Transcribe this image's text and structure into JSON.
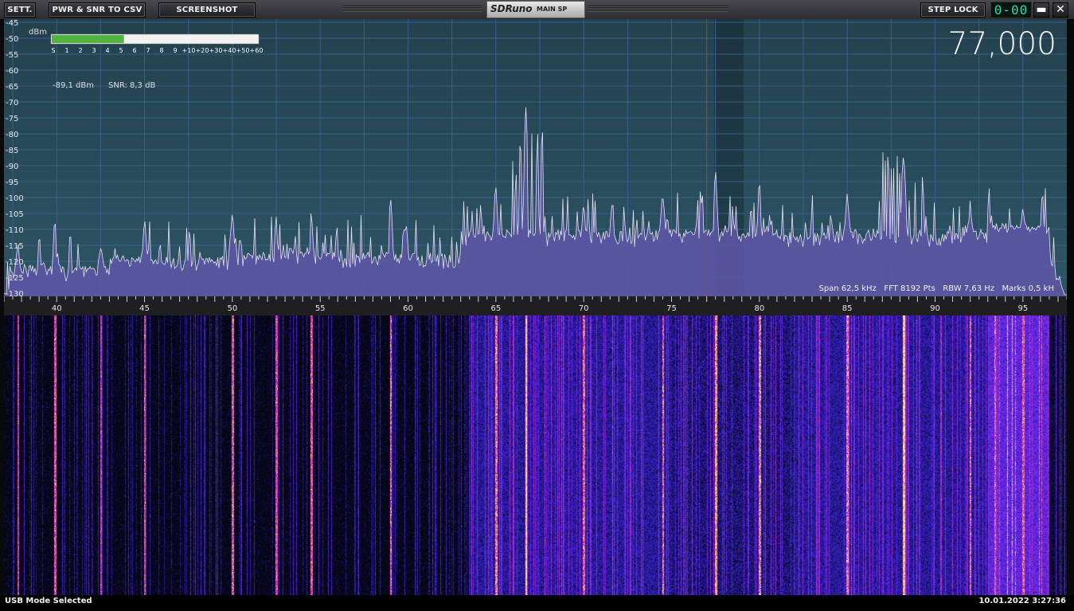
{
  "toolbar": {
    "settings_label": "SETT.",
    "pwr_snr_label": "PWR & SNR TO CSV",
    "screenshot_label": "SCREENSHOT",
    "title_app": "SDRuno",
    "title_window": "MAIN SP",
    "step_lock_label": "STEP LOCK",
    "step_display": "0-00",
    "minimize_glyph": "▬",
    "close_glyph": "✕"
  },
  "spectrum": {
    "unit_label": "dBm",
    "y_ticks": [
      "-45",
      "-50",
      "-55",
      "-60",
      "-65",
      "-70",
      "-75",
      "-80",
      "-85",
      "-90",
      "-95",
      "-100",
      "-105",
      "-110",
      "-115",
      "-120",
      "-125",
      "-130"
    ],
    "x_ticks": [
      "40",
      "45",
      "50",
      "55",
      "60",
      "65",
      "70",
      "75",
      "80",
      "85",
      "90",
      "95"
    ],
    "smeter_scale": [
      "S",
      "1",
      "2",
      "3",
      "4",
      "5",
      "6",
      "7",
      "8",
      "9",
      "+10",
      "+20",
      "+30",
      "+40",
      "+50",
      "+60"
    ],
    "smeter_level": 0.35,
    "power_readout": "-89,1 dBm",
    "snr_readout": "SNR: 8,3 dB",
    "frequency_display": "77,000",
    "info_line": "Span 62,5 kHz   FFT 8192 Pts   RBW 7,63 Hz   Marks 0,5 kH",
    "colors": {
      "background": "#24434f",
      "grid": "#3b5d8e",
      "trace": "#e2e0ee",
      "fill": "#5f56a8",
      "marker": "#c0392b",
      "smeter_bar": "#52b33f"
    }
  },
  "chart_data": {
    "type": "line",
    "xlabel": "",
    "ylabel": "dBm",
    "xlim": [
      37.0,
      97.5
    ],
    "ylim": [
      -131,
      -44
    ],
    "tuned_frequency": 77.0,
    "peaks": [
      {
        "x": 37.8,
        "y": -115
      },
      {
        "x": 39.9,
        "y": -106
      },
      {
        "x": 42.5,
        "y": -117
      },
      {
        "x": 45.0,
        "y": -109
      },
      {
        "x": 50.0,
        "y": -105
      },
      {
        "x": 52.5,
        "y": -108
      },
      {
        "x": 54.5,
        "y": -107
      },
      {
        "x": 59.0,
        "y": -102
      },
      {
        "x": 65.0,
        "y": -98
      },
      {
        "x": 66.7,
        "y": -73
      },
      {
        "x": 70.0,
        "y": -102
      },
      {
        "x": 74.5,
        "y": -100
      },
      {
        "x": 77.5,
        "y": -91
      },
      {
        "x": 80.0,
        "y": -98
      },
      {
        "x": 85.0,
        "y": -98
      },
      {
        "x": 88.2,
        "y": -79
      },
      {
        "x": 92.0,
        "y": -102
      },
      {
        "x": 95.0,
        "y": -104
      }
    ]
  },
  "status": {
    "mode": "USB Mode Selected",
    "datetime": "10.01.2022 3:27:36"
  }
}
